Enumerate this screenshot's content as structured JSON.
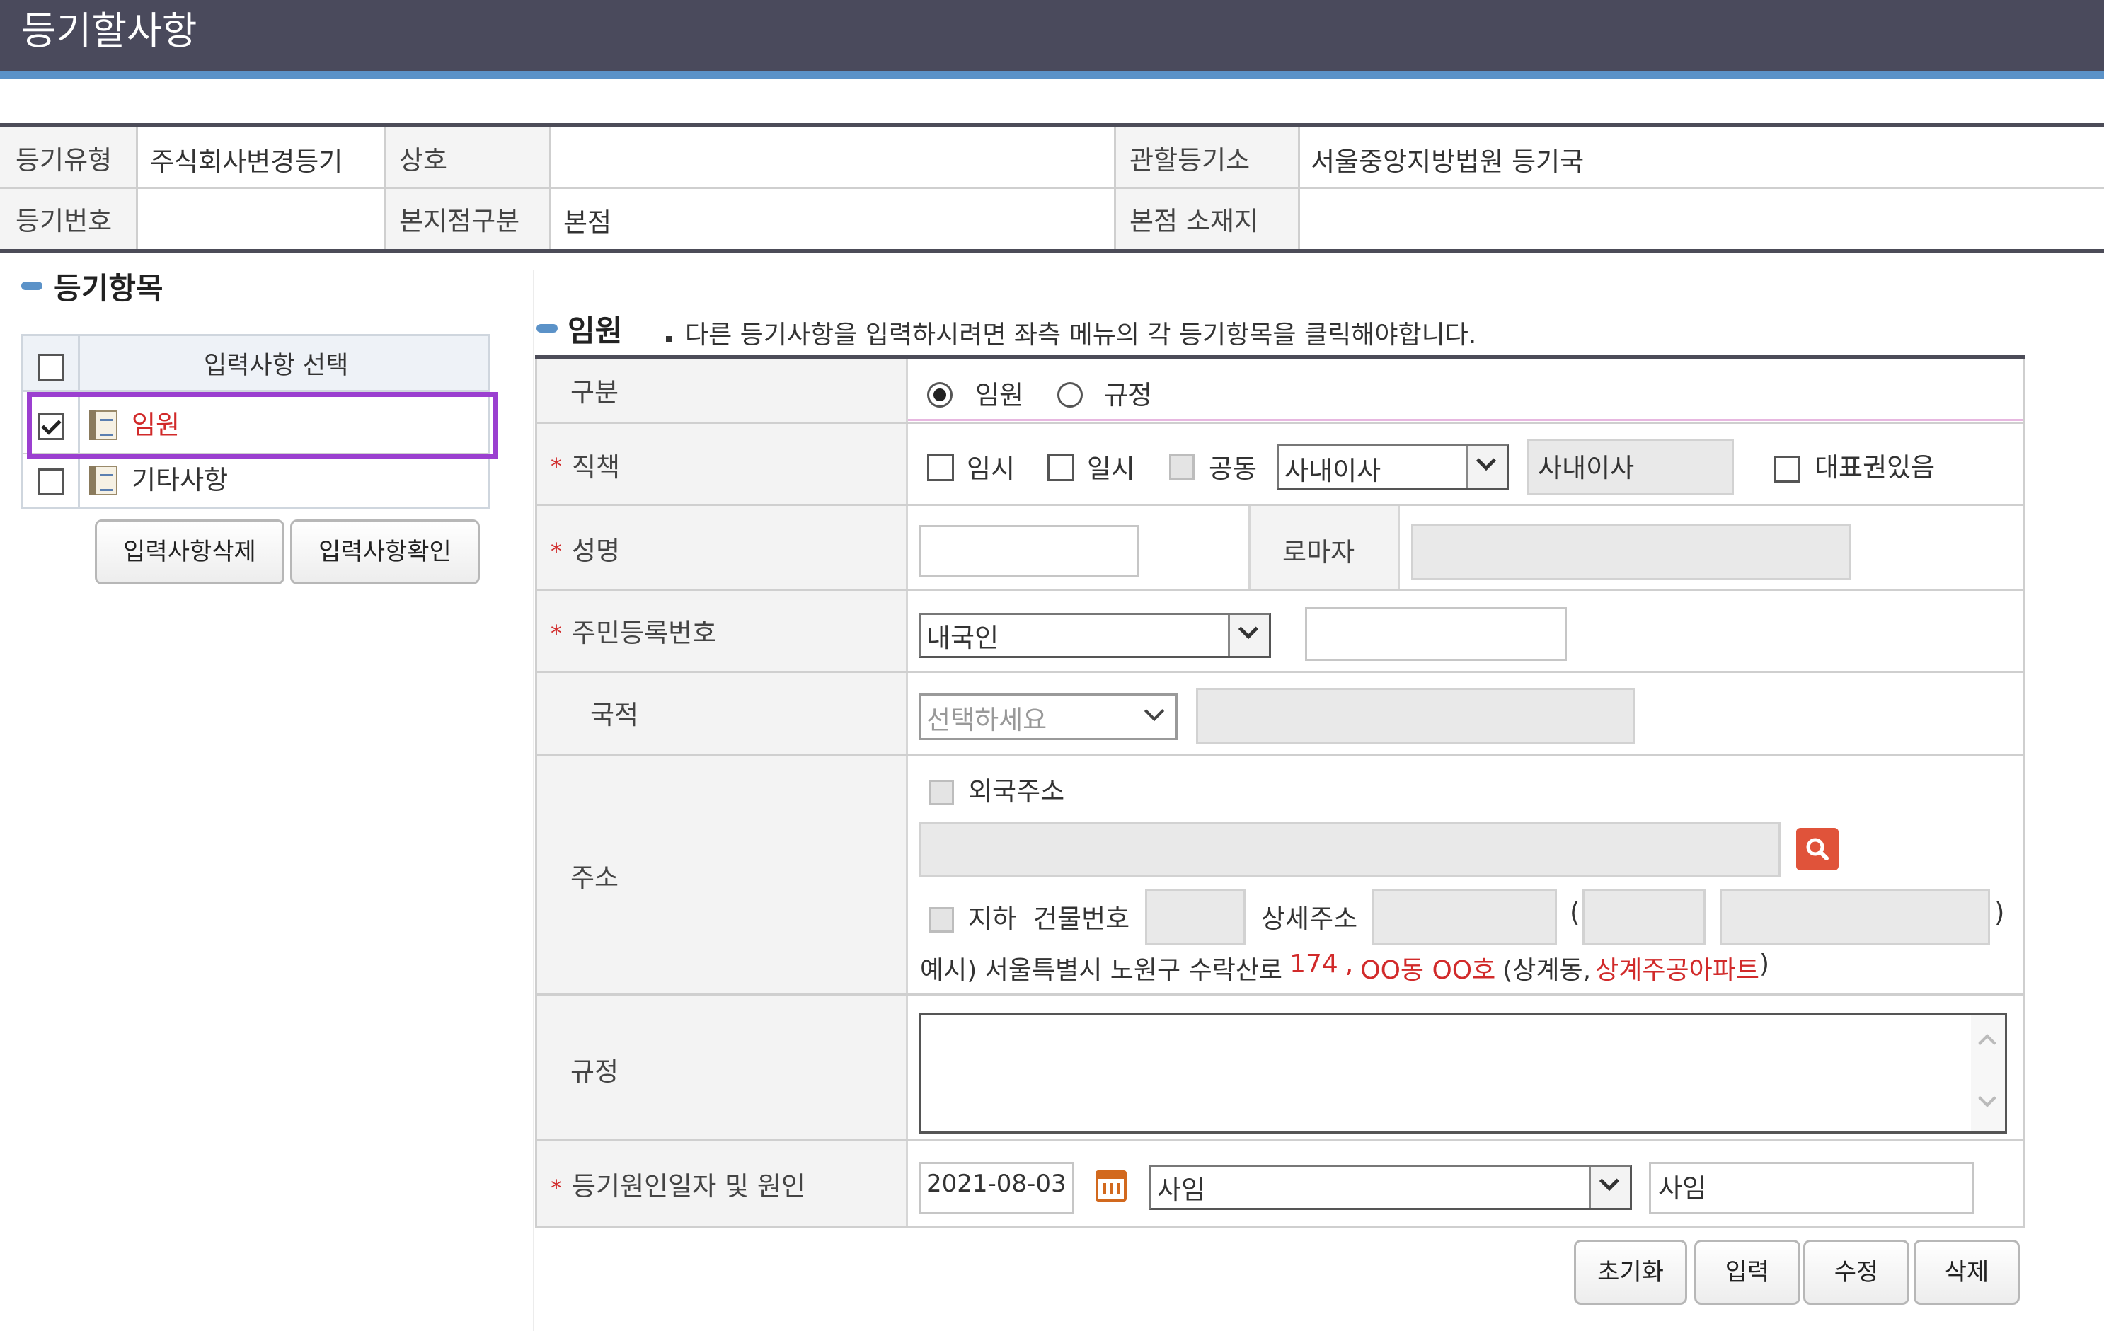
{
  "header": {
    "title": "등기할사항"
  },
  "info_table": {
    "reg_type_label": "등기유형",
    "reg_type_value": "주식회사변경등기",
    "trade_name_label": "상호",
    "trade_name_value": "",
    "office_label": "관할등기소",
    "office_value": "서울중앙지방법원 등기국",
    "reg_number_label": "등기번호",
    "reg_number_value": "",
    "branch_type_label": "본지점구분",
    "branch_type_value": "본점",
    "hq_location_label": "본점 소재지",
    "hq_location_value": ""
  },
  "left": {
    "section_title": "등기항목",
    "column_header": "입력사항 선택",
    "items": [
      {
        "label": "임원",
        "checked": true,
        "highlight_color": "#9b3fd0",
        "text_color": "#d12a2a"
      },
      {
        "label": "기타사항",
        "checked": false
      }
    ],
    "delete_button": "입력사항삭제",
    "confirm_button": "입력사항확인"
  },
  "form": {
    "section_title": "임원",
    "notice": "다른 등기사항을 입력하시려면 좌측 메뉴의 각 등기항목을 클릭해야합니다.",
    "required_marker": "*",
    "division": {
      "label": "구분",
      "option_officer": "임원",
      "option_rule": "규정",
      "selected": "임원"
    },
    "position": {
      "label": "직책",
      "temp_label": "임시",
      "once_label": "일시",
      "joint_label": "공동",
      "select_value": "사내이사",
      "display_value": "사내이사",
      "representative_label": "대표권있음"
    },
    "name": {
      "label": "성명",
      "value": "",
      "roman_label": "로마자",
      "roman_value": ""
    },
    "resident_number": {
      "label": "주민등록번호",
      "select_value": "내국인",
      "value": ""
    },
    "nationality": {
      "label": "국적",
      "select_placeholder": "선택하세요",
      "value": ""
    },
    "address": {
      "label": "주소",
      "foreign_label": "외국주소",
      "address_value": "",
      "basement_label": "지하",
      "building_no_label": "건물번호",
      "detail_label": "상세주소",
      "open_paren": "(",
      "close_paren": ")",
      "example_prefix": "예시) 서울특별시 노원구 수락산로",
      "example_number": "174",
      "example_comma": ",",
      "example_unit": "OO동 OO호",
      "example_paren_open": "(상계동,",
      "example_apartment": "상계주공아파트",
      "example_paren_close": ")"
    },
    "rule": {
      "label": "규정",
      "value": ""
    },
    "reason": {
      "label": "등기원인일자 및 원인",
      "date_value": "2021-08-03",
      "select_value": "사임",
      "display_value": "사임"
    }
  },
  "actions": {
    "reset": "초기화",
    "input": "입력",
    "modify": "수정",
    "delete": "삭제"
  },
  "colors": {
    "header_bg": "#4a4a5c",
    "accent_blue": "#5b92c8",
    "required_red": "#d12a2a",
    "selection_purple": "#9b3fd0",
    "search_button": "#e0533a"
  }
}
